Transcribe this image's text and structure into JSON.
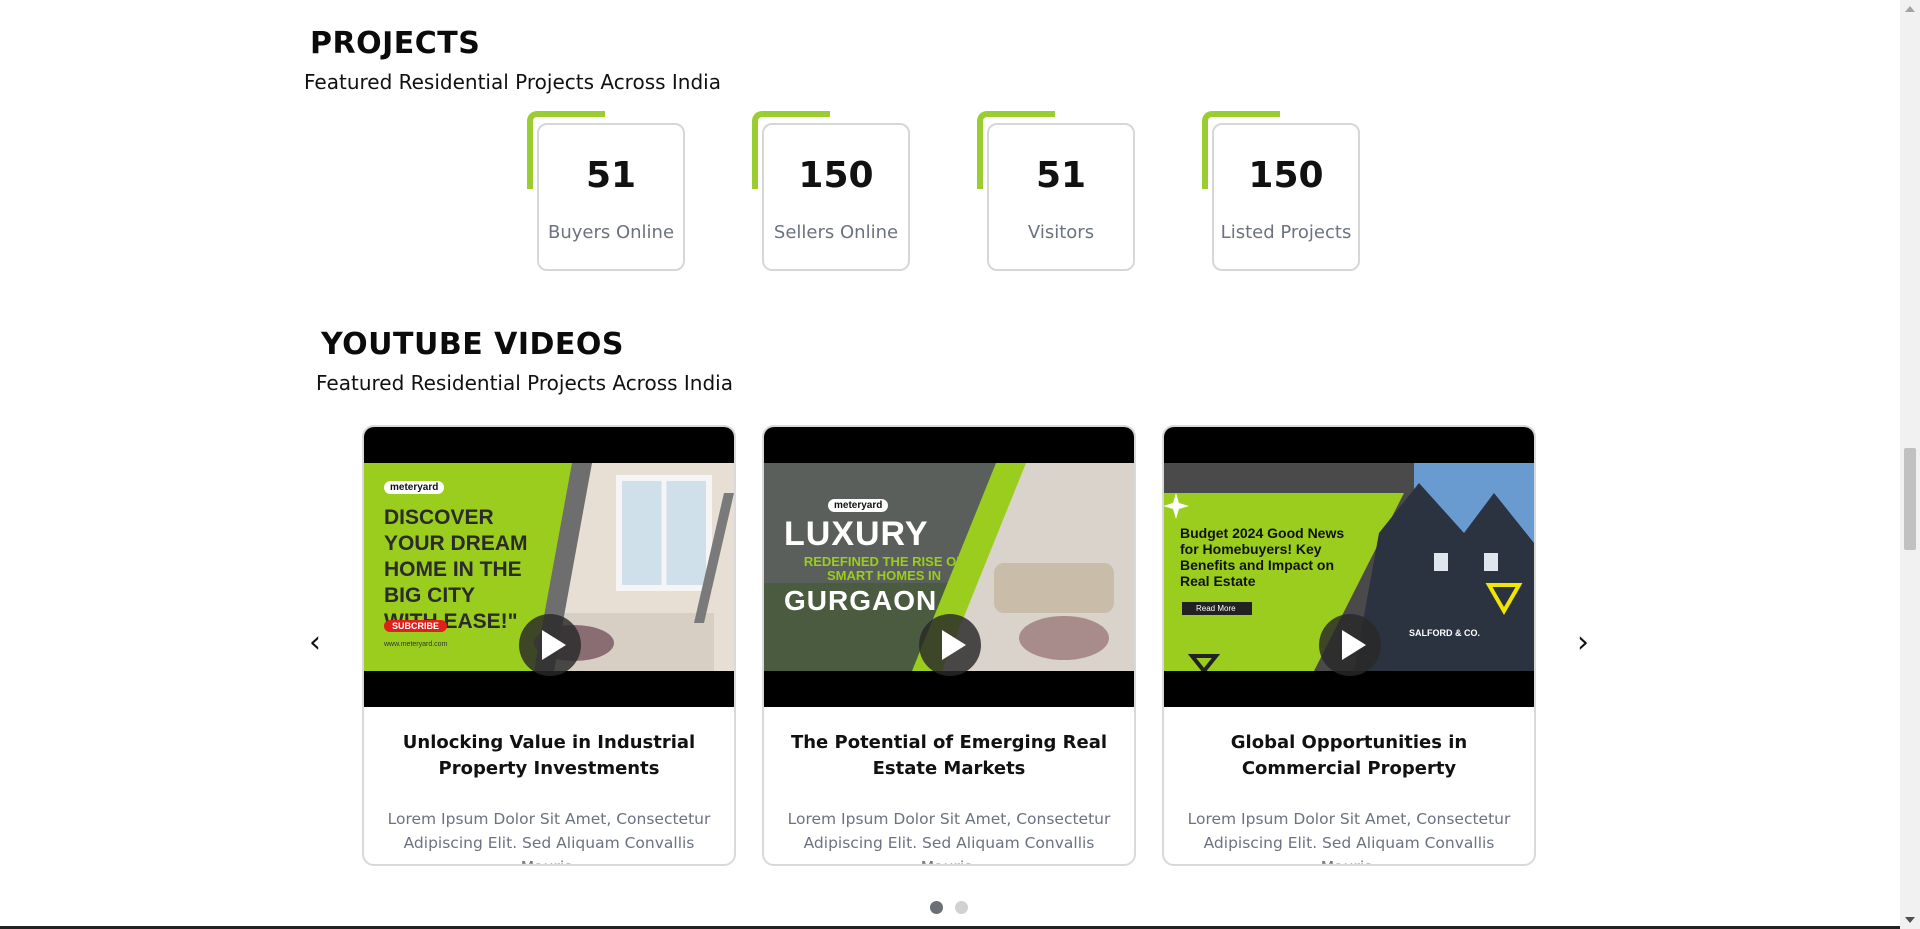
{
  "projects": {
    "title": "PROJECTS",
    "subtitle": "Featured Residential Projects Across India",
    "stats": [
      {
        "value": "51",
        "label": "Buyers Online"
      },
      {
        "value": "150",
        "label": "Sellers Online"
      },
      {
        "value": "51",
        "label": "Visitors"
      },
      {
        "value": "150",
        "label": "Listed Projects"
      }
    ]
  },
  "videos": {
    "title": "YOUTUBE VIDEOS",
    "subtitle": "Featured Residential Projects Across India",
    "prev_icon": "chevron-left-icon",
    "next_icon": "chevron-right-icon",
    "cards": [
      {
        "title": "Unlocking Value in Industrial Property Investments",
        "description": "Lorem Ipsum Dolor Sit Amet, Consectetur Adipiscing Elit. Sed Aliquam Convallis Mauris.",
        "thumb": {
          "brand": "meteryard",
          "headline": "DISCOVER YOUR DREAM HOME IN THE BIG CITY WITH EASE!\"",
          "cta": "SUBCRIBE",
          "url": "www.meteryard.com"
        }
      },
      {
        "title": "The Potential of Emerging Real Estate Markets",
        "description": "Lorem Ipsum Dolor Sit Amet, Consectetur Adipiscing Elit. Sed Aliquam Convallis Mauris.",
        "thumb": {
          "brand": "meteryard",
          "headline": "LUXURY",
          "sub": "REDEFINED THE RISE OF SMART HOMES IN",
          "city": "GURGAON"
        }
      },
      {
        "title": "Global Opportunities in Commercial Property",
        "description": "Lorem Ipsum Dolor Sit Amet, Consectetur Adipiscing Elit. Sed Aliquam Convallis Mauris.",
        "thumb": {
          "headline": "Budget 2024 Good News for Homebuyers! Key Benefits and Impact on Real Estate",
          "cta": "Read More",
          "company": "SALFORD & CO."
        }
      }
    ],
    "pagination": {
      "pages": 2,
      "active": 1
    }
  },
  "colors": {
    "accent": "#9acd32",
    "text_muted": "#6b7280"
  }
}
